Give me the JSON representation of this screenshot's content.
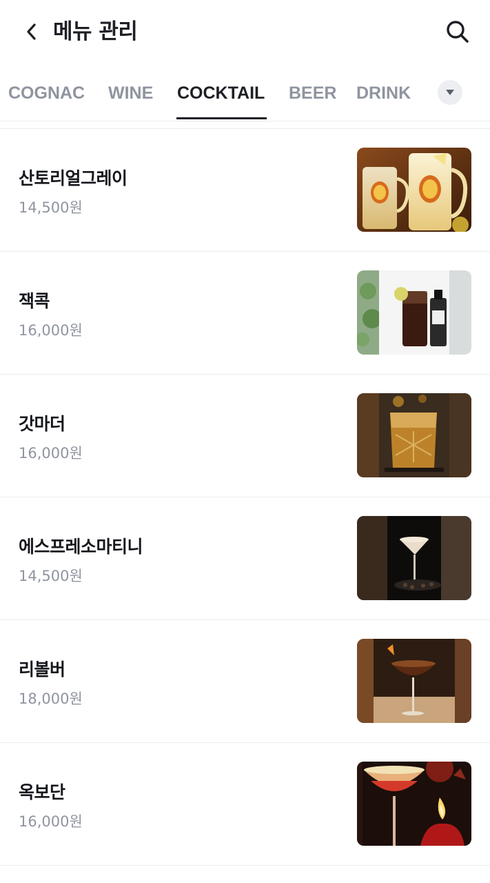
{
  "header": {
    "title": "메뉴 관리",
    "back_icon": "chevron-left-icon",
    "search_icon": "search-icon"
  },
  "tabs": [
    {
      "label": "COGNAC",
      "active": false
    },
    {
      "label": "WINE",
      "active": false
    },
    {
      "label": "COCKTAIL",
      "active": true
    },
    {
      "label": "BEER",
      "active": false
    },
    {
      "label": "DRINK",
      "active": false
    }
  ],
  "tabs_more_icon": "caret-down-icon",
  "menu_items": [
    {
      "name": "산토리얼그레이",
      "price": "14,500원",
      "image": "highball-mugs-photo"
    },
    {
      "name": "잭콕",
      "price": "16,000원",
      "image": "jack-coke-photo"
    },
    {
      "name": "갓마더",
      "price": "16,000원",
      "image": "rocks-glass-photo"
    },
    {
      "name": "에스프레소마티니",
      "price": "14,500원",
      "image": "espresso-martini-photo"
    },
    {
      "name": "리볼버",
      "price": "18,000원",
      "image": "coupe-cocktail-photo"
    },
    {
      "name": "옥보단",
      "price": "16,000원",
      "image": "margarita-candle-photo"
    }
  ],
  "colors": {
    "text_primary": "#1d1f25",
    "text_secondary": "#8f94a0",
    "divider": "#ececee",
    "chip_bg": "#eceef2"
  }
}
